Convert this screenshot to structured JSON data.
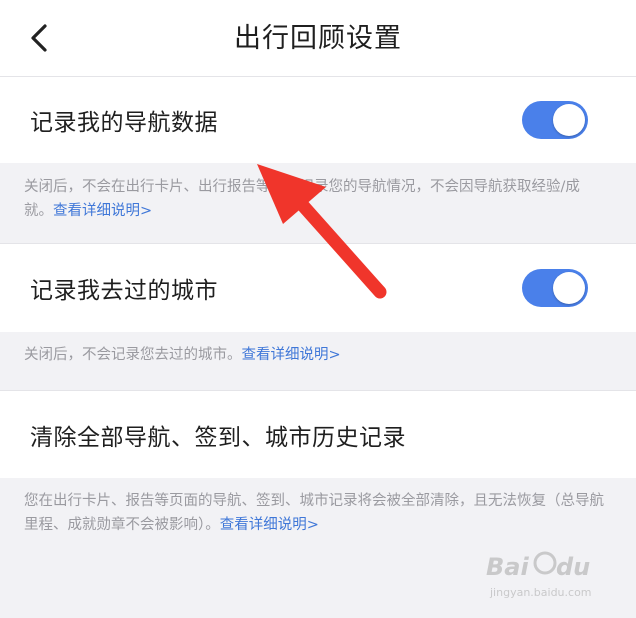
{
  "header": {
    "title": "出行回顾设置",
    "back_icon": "chevron-left-icon"
  },
  "settings": [
    {
      "label": "记录我的导航数据",
      "toggle_on": true,
      "note": "关闭后，不会在出行卡片、出行报告等页面记录您的导航情况，不会因导航获取经验/成就。",
      "link": "查看详细说明>"
    },
    {
      "label": "记录我去过的城市",
      "toggle_on": true,
      "note": "关闭后，不会记录您去过的城市。",
      "link": "查看详细说明>"
    },
    {
      "label": "清除全部导航、签到、城市历史记录",
      "note": "您在出行卡片、报告等页面的导航、签到、城市记录将会被全部清除，且无法恢复（总导航里程、成就勋章不会被影响）。",
      "link": "查看详细说明>"
    }
  ],
  "watermark": {
    "logo": "Bai du 经验",
    "url": "jingyan.baidu.com"
  },
  "colors": {
    "toggle_on": "#4a80ea",
    "link": "#3f77d8",
    "annotation_arrow": "#f0352b"
  }
}
